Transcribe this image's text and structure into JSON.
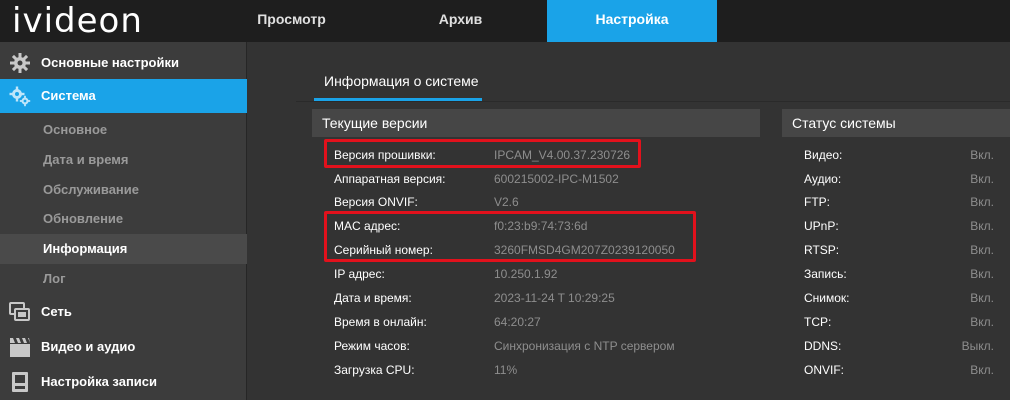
{
  "header": {
    "logo": "ivideon",
    "tabs": [
      {
        "label": "Просмотр"
      },
      {
        "label": "Архив"
      },
      {
        "label": "Настройка"
      }
    ],
    "active_tab": "Настройка",
    "accent": "#1aa3e8"
  },
  "sidebar": {
    "sections": [
      {
        "label": "Основные настройки",
        "icon": "gear-icon"
      },
      {
        "label": "Система",
        "icon": "gears-icon"
      }
    ],
    "system_items": [
      {
        "label": "Основное"
      },
      {
        "label": "Дата и время"
      },
      {
        "label": "Обслуживание"
      },
      {
        "label": "Обновление"
      },
      {
        "label": "Информация"
      },
      {
        "label": "Лог"
      }
    ],
    "more_sections": [
      {
        "label": "Сеть",
        "icon": "network-icon"
      },
      {
        "label": "Видео и аудио",
        "icon": "clapperboard-icon"
      },
      {
        "label": "Настройка записи",
        "icon": "storage-icon"
      }
    ]
  },
  "main": {
    "title": "Информация о системе",
    "versions_header": "Текущие версии",
    "status_header": "Статус системы",
    "info": [
      {
        "key": "Версия прошивки:",
        "value": "IPCAM_V4.00.37.230726"
      },
      {
        "key": "Аппаратная версия:",
        "value": "600215002-IPC-M1502"
      },
      {
        "key": "Версия ONVIF:",
        "value": "V2.6"
      },
      {
        "key": "MAC адрес:",
        "value": "f0:23:b9:74:73:6d"
      },
      {
        "key": "Серийный номер:",
        "value": "3260FMSD4GM207Z0239120050"
      },
      {
        "key": "IP адрес:",
        "value": "10.250.1.92"
      },
      {
        "key": "Дата и время:",
        "value": "2023-11-24 T 10:29:25"
      },
      {
        "key": "Время в онлайн:",
        "value": "64:20:27"
      },
      {
        "key": "Режим часов:",
        "value": "Синхронизация с NTP сервером"
      },
      {
        "key": "Загрузка CPU:",
        "value": "11%"
      }
    ],
    "status": [
      {
        "key": "Видео:",
        "value": "Вкл."
      },
      {
        "key": "Аудио:",
        "value": "Вкл."
      },
      {
        "key": "FTP:",
        "value": "Вкл."
      },
      {
        "key": "UPnP:",
        "value": "Вкл."
      },
      {
        "key": "RTSP:",
        "value": "Вкл."
      },
      {
        "key": "Запись:",
        "value": "Вкл."
      },
      {
        "key": "Снимок:",
        "value": "Вкл."
      },
      {
        "key": "TCP:",
        "value": "Вкл."
      },
      {
        "key": "DDNS:",
        "value": "Выкл."
      },
      {
        "key": "ONVIF:",
        "value": "Вкл."
      }
    ],
    "highlight_color": "#e2111c"
  }
}
